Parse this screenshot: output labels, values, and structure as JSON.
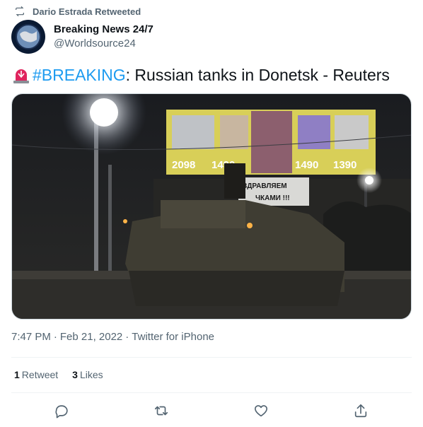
{
  "retweet": {
    "label": "Dario Estrada Retweeted"
  },
  "author": {
    "name": "Breaking News 24/7",
    "handle": "@Worldsource24"
  },
  "tweet": {
    "hashtag": "#BREAKING",
    "text": ": Russian tanks in Donetsk - Reuters"
  },
  "media": {
    "billboard_prices": [
      "2098",
      "1490",
      "1490",
      "1390"
    ],
    "banner_lines": [
      "ЗДРАВЛЯЕМ",
      "ЧКАМИ !!!"
    ]
  },
  "meta": {
    "time": "7:47 PM",
    "separator": "·",
    "date": "Feb 21, 2022",
    "source": "Twitter for iPhone"
  },
  "stats": {
    "retweets_count": "1",
    "retweets_label": "Retweet",
    "likes_count": "3",
    "likes_label": "Likes"
  },
  "colors": {
    "accent": "#1d9bf0",
    "secondary": "#536471",
    "siren": "#e0245e"
  },
  "icons": [
    "retweet-icon",
    "siren-emoji-icon",
    "reply-icon",
    "like-icon",
    "share-icon"
  ]
}
